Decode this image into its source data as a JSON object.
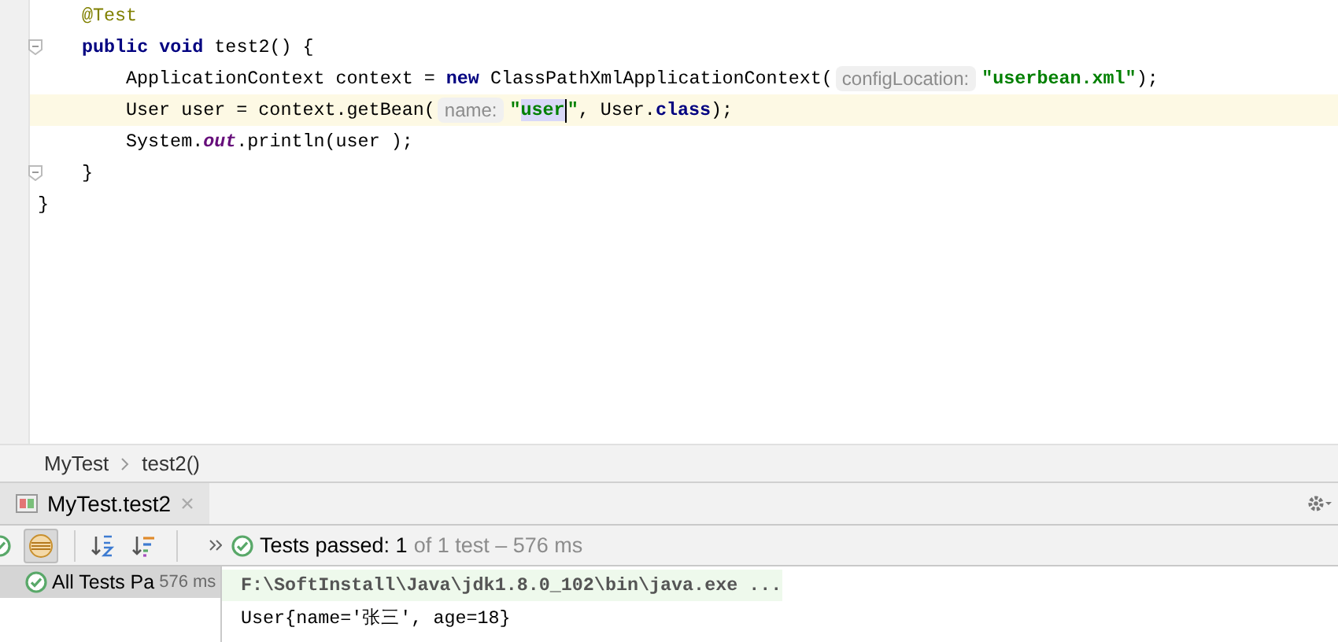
{
  "editor": {
    "lines": [
      {
        "children": [
          {
            "tokens": [
              {
                "kind": "annotation",
                "text": "@Test"
              }
            ]
          },
          {
            "fold": true,
            "tokens": [
              {
                "kind": "keyword",
                "text": "public void"
              },
              {
                "kind": "plain",
                "text": " test2() {"
              }
            ],
            "children": [
              {
                "tokens": [
                  {
                    "kind": "plain",
                    "text": "ApplicationContext context = "
                  },
                  {
                    "kind": "keyword",
                    "text": "new"
                  },
                  {
                    "kind": "plain",
                    "text": " ClassPathXmlApplicationContext("
                  },
                  {
                    "kind": "hint",
                    "text": "configLocation:"
                  },
                  {
                    "kind": "string",
                    "text": "\"userbean.xml\""
                  },
                  {
                    "kind": "plain",
                    "text": ");"
                  }
                ]
              },
              {
                "current": true,
                "tokens": [
                  {
                    "kind": "plain",
                    "text": "User user = context.getBean("
                  },
                  {
                    "kind": "hint",
                    "text": "name:"
                  },
                  {
                    "kind": "string",
                    "text": "\""
                  },
                  {
                    "kind": "selected-string",
                    "text": "user"
                  },
                  {
                    "kind": "caret"
                  },
                  {
                    "kind": "string",
                    "text": "\""
                  },
                  {
                    "kind": "plain",
                    "text": ", User."
                  },
                  {
                    "kind": "keyword",
                    "text": "class"
                  },
                  {
                    "kind": "plain",
                    "text": ");"
                  }
                ]
              },
              {
                "tokens": [
                  {
                    "kind": "plain",
                    "text": "System."
                  },
                  {
                    "kind": "field",
                    "text": "out"
                  },
                  {
                    "kind": "plain",
                    "text": ".println(user );"
                  }
                ]
              }
            ]
          },
          {
            "fold": true,
            "tokens": [
              {
                "kind": "plain",
                "text": "}"
              }
            ]
          }
        ]
      },
      {
        "tokens": [
          {
            "kind": "plain",
            "text": "}"
          }
        ]
      }
    ]
  },
  "breadcrumbs": [
    "MyTest",
    "test2()"
  ],
  "run_panel": {
    "tabs": [
      {
        "label": "MyTest.test2",
        "selected": true
      }
    ],
    "toolbar": [
      {
        "kind": "pass-check"
      },
      {
        "kind": "show-passed",
        "on": true
      },
      {
        "kind": "sort-alpha",
        "on": false
      },
      {
        "kind": "sort-duration",
        "on": false
      }
    ],
    "status": {
      "label": "Tests passed: 1",
      "detail": "of 1 test – 576 ms"
    },
    "tree": [
      {
        "label": "All Tests Pa",
        "time": "576 ms",
        "selected": true
      }
    ],
    "console": [
      {
        "kind": "command",
        "text": "F:\\SoftInstall\\Java\\jdk1.8.0_102\\bin\\java.exe ..."
      },
      {
        "kind": "output",
        "text": "User{name='张三', age=18}"
      }
    ]
  }
}
